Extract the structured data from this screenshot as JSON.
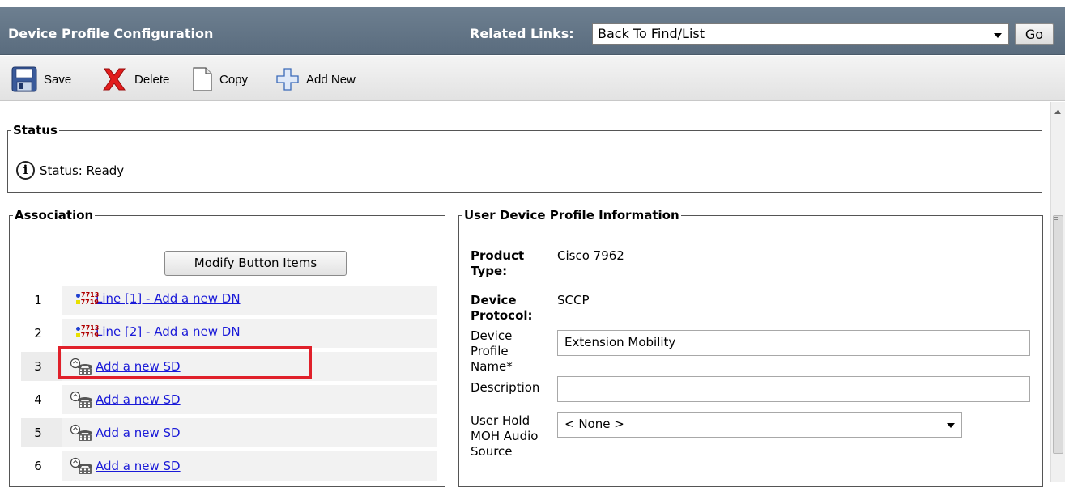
{
  "header": {
    "title": "Device Profile Configuration",
    "related_links_label": "Related Links:",
    "related_links_value": "Back To Find/List",
    "go_label": "Go"
  },
  "toolbar": {
    "save_label": "Save",
    "delete_label": "Delete",
    "copy_label": "Copy",
    "add_new_label": "Add New"
  },
  "status": {
    "legend": "Status",
    "text": "Status: Ready"
  },
  "association": {
    "legend": "Association",
    "modify_button_label": "Modify Button Items",
    "rows": [
      {
        "num": "1",
        "label": "Line [1] - Add a new DN",
        "icon": "line-icon"
      },
      {
        "num": "2",
        "label": "Line [2] - Add a new DN",
        "icon": "line-icon"
      },
      {
        "num": "3",
        "label": "Add a new SD",
        "icon": "speed-dial-icon"
      },
      {
        "num": "4",
        "label": "Add a new SD",
        "icon": "speed-dial-icon"
      },
      {
        "num": "5",
        "label": "Add a new SD",
        "icon": "speed-dial-icon"
      },
      {
        "num": "6",
        "label": "Add a new SD",
        "icon": "speed-dial-icon"
      }
    ],
    "highlight_color": "#e0202a"
  },
  "udp": {
    "legend": "User Device Profile Information",
    "product_type_label_1": "Product",
    "product_type_label_2": "Type:",
    "product_type_value": "Cisco 7962",
    "device_protocol_label_1": "Device",
    "device_protocol_label_2": "Protocol:",
    "device_protocol_value": "SCCP",
    "profile_name_label_1": "Device",
    "profile_name_label_2": "Profile",
    "profile_name_label_3": "Name*",
    "profile_name_value": "Extension Mobility",
    "description_label": "Description",
    "description_value": "",
    "moh_label_1": "User Hold",
    "moh_label_2": "MOH Audio",
    "moh_label_3": "Source",
    "moh_value": "< None >"
  },
  "colors": {
    "header_bg": "#5f7183",
    "link": "#1a1ad8"
  }
}
